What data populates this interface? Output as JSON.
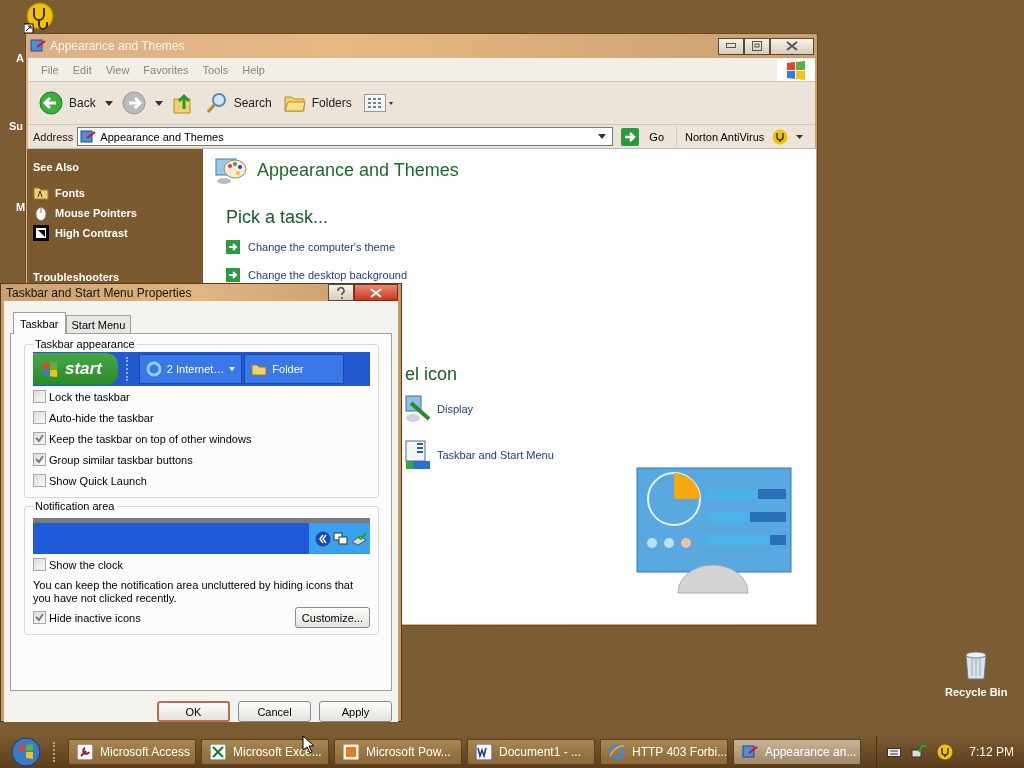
{
  "desktop": {
    "icon_labels": [
      "A",
      "Su",
      "M"
    ],
    "recycle_bin": "Recycle Bin"
  },
  "explorer": {
    "title": "Appearance and Themes",
    "menu": [
      "File",
      "Edit",
      "View",
      "Favorites",
      "Tools",
      "Help"
    ],
    "toolbar": [
      {
        "kind": "back",
        "label": "Back"
      },
      {
        "kind": "forward"
      },
      {
        "kind": "up"
      },
      {
        "kind": "search",
        "label": "Search"
      },
      {
        "kind": "folders",
        "label": "Folders"
      },
      {
        "kind": "views"
      }
    ],
    "address": {
      "label": "Address",
      "value": "Appearance and Themes",
      "go": "Go",
      "norton": "Norton AntiVirus"
    },
    "sidebar": {
      "see_also": "See Also",
      "items": [
        {
          "kind": "fonts",
          "label": "Fonts"
        },
        {
          "kind": "mouse",
          "label": "Mouse Pointers"
        },
        {
          "kind": "contrast",
          "label": "High Contrast"
        }
      ],
      "troubleshooters": "Troubleshooters"
    },
    "heading": "Appearance and Themes",
    "pick_task": "Pick a task...",
    "tasks": [
      "Change the computer's theme",
      "Change the desktop background"
    ],
    "pick_icon": "el icon",
    "icons": [
      {
        "kind": "display",
        "label": "Display"
      },
      {
        "kind": "taskbar",
        "label": "Taskbar and Start Menu"
      }
    ]
  },
  "dialog": {
    "title": "Taskbar and Start Menu Properties",
    "tabs": [
      {
        "label": "Taskbar",
        "selected": true
      },
      {
        "label": "Start Menu",
        "selected": false
      }
    ],
    "appearance": {
      "title": "Taskbar appearance",
      "start": "start",
      "preview_buttons": [
        "2 Internet…",
        "Folder"
      ],
      "options": [
        {
          "label": "Lock the taskbar",
          "checked": false
        },
        {
          "label": "Auto-hide the taskbar",
          "checked": false
        },
        {
          "label": "Keep the taskbar on top of other windows",
          "checked": true
        },
        {
          "label": "Group similar taskbar buttons",
          "checked": true
        },
        {
          "label": "Show Quick Launch",
          "checked": false
        }
      ]
    },
    "notification": {
      "title": "Notification area",
      "clock": {
        "label": "Show the clock",
        "checked": false
      },
      "description": "You can keep the notification area uncluttered by hiding icons that you have not clicked recently.",
      "hide": {
        "label": "Hide inactive icons",
        "checked": true
      },
      "customize": "Customize..."
    },
    "buttons": [
      {
        "label": "OK",
        "default": true
      },
      {
        "label": "Cancel",
        "default": false
      },
      {
        "label": "Apply",
        "default": false
      }
    ]
  },
  "taskbar": {
    "buttons": [
      {
        "kind": "access",
        "label": "Microsoft Access",
        "selected": false
      },
      {
        "kind": "excel",
        "label": "Microsoft Exce...",
        "selected": false
      },
      {
        "kind": "powerpoint",
        "label": "Microsoft Pow...",
        "selected": false
      },
      {
        "kind": "word",
        "label": "Document1 - ...",
        "selected": false
      },
      {
        "kind": "ie",
        "label": "HTTP 403 Forbi...",
        "selected": false
      },
      {
        "kind": "cpl",
        "label": "Appearance an...",
        "selected": true
      }
    ],
    "time": "7:12 PM"
  }
}
